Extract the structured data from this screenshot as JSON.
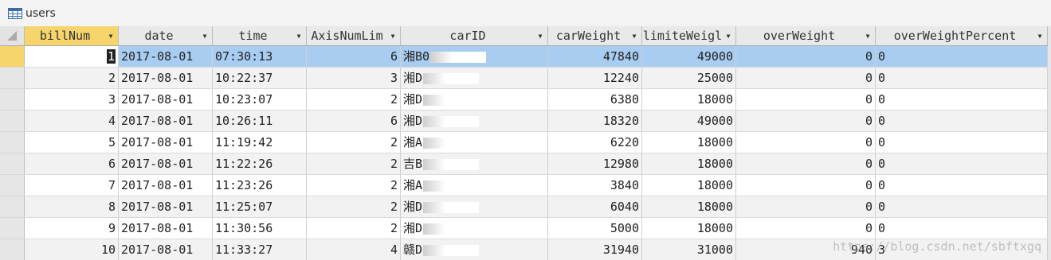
{
  "window": {
    "table_name": "users",
    "table_icon": "table-icon"
  },
  "columns": [
    {
      "label": "billNum"
    },
    {
      "label": "date"
    },
    {
      "label": "time"
    },
    {
      "label": "AxisNumLim"
    },
    {
      "label": "carID"
    },
    {
      "label": "carWeight"
    },
    {
      "label": "limiteWeigl"
    },
    {
      "label": "overWeight"
    },
    {
      "label": "overWeightPercent"
    }
  ],
  "rows": [
    {
      "billNum": "1",
      "date": "2017-08-01",
      "time": "07:30:13",
      "axis": "6",
      "carID": "湘B0",
      "carWeight": "47840",
      "limit": "49000",
      "over": "0",
      "percent": "0"
    },
    {
      "billNum": "2",
      "date": "2017-08-01",
      "time": "10:22:37",
      "axis": "3",
      "carID": "湘D",
      "carWeight": "12240",
      "limit": "25000",
      "over": "0",
      "percent": "0"
    },
    {
      "billNum": "3",
      "date": "2017-08-01",
      "time": "10:23:07",
      "axis": "2",
      "carID": "湘D",
      "carWeight": "6380",
      "limit": "18000",
      "over": "0",
      "percent": "0"
    },
    {
      "billNum": "4",
      "date": "2017-08-01",
      "time": "10:26:11",
      "axis": "6",
      "carID": "湘D",
      "carWeight": "18320",
      "limit": "49000",
      "over": "0",
      "percent": "0"
    },
    {
      "billNum": "5",
      "date": "2017-08-01",
      "time": "11:19:42",
      "axis": "2",
      "carID": "湘A",
      "carWeight": "6220",
      "limit": "18000",
      "over": "0",
      "percent": "0"
    },
    {
      "billNum": "6",
      "date": "2017-08-01",
      "time": "11:22:26",
      "axis": "2",
      "carID": "吉B",
      "carWeight": "12980",
      "limit": "18000",
      "over": "0",
      "percent": "0"
    },
    {
      "billNum": "7",
      "date": "2017-08-01",
      "time": "11:23:26",
      "axis": "2",
      "carID": "湘A",
      "carWeight": "3840",
      "limit": "18000",
      "over": "0",
      "percent": "0"
    },
    {
      "billNum": "8",
      "date": "2017-08-01",
      "time": "11:25:07",
      "axis": "2",
      "carID": "湘D",
      "carWeight": "6040",
      "limit": "18000",
      "over": "0",
      "percent": "0"
    },
    {
      "billNum": "9",
      "date": "2017-08-01",
      "time": "11:30:56",
      "axis": "2",
      "carID": "湘D",
      "carWeight": "5000",
      "limit": "18000",
      "over": "0",
      "percent": "0"
    },
    {
      "billNum": "10",
      "date": "2017-08-01",
      "time": "11:33:27",
      "axis": "4",
      "carID": "赣D",
      "carWeight": "31940",
      "limit": "31000",
      "over": "940",
      "percent": "3"
    }
  ],
  "selected_row": 0,
  "watermark": "https://blog.csdn.net/sbftxgq",
  "colors": {
    "header_bg": "#e9e9e9",
    "active_header": "#f7d56d",
    "selected_row": "#a9cdf0",
    "alt_row": "#f2f2f2"
  }
}
